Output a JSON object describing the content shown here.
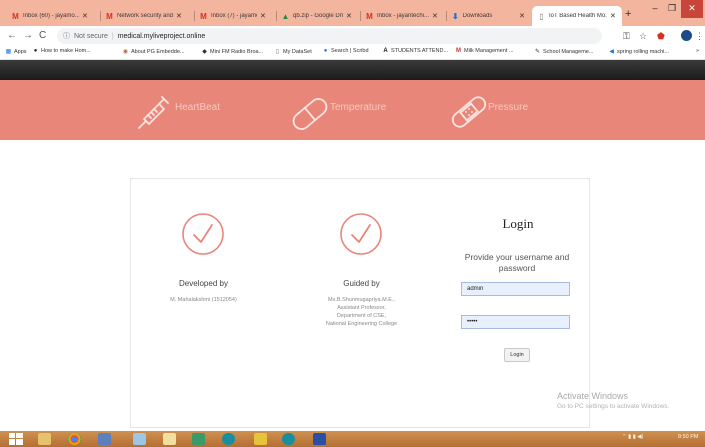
{
  "browser": {
    "tabs": [
      {
        "title": "Inbox (60) - jayamo..."
      },
      {
        "title": "Network security and..."
      },
      {
        "title": "Inbox (7) - jayamoha..."
      },
      {
        "title": "qb.zip - Google Drive"
      },
      {
        "title": "Inbox - jayantechi..."
      },
      {
        "title": "Downloads"
      },
      {
        "title": "IoT Based Health Mo..."
      }
    ],
    "address": {
      "security_label": "Not secure",
      "url": "medical.myliveproject.online"
    },
    "bookmarks": [
      {
        "label": "Apps"
      },
      {
        "label": "How to make Hom..."
      },
      {
        "label": "About PG Embedde..."
      },
      {
        "label": "Mini FM Radio Broa..."
      },
      {
        "label": "My DataSet"
      },
      {
        "label": "Search | Scribd"
      },
      {
        "label": "STUDENTS ATTEND..."
      },
      {
        "label": "Milk Management ..."
      },
      {
        "label": "School Manageme..."
      },
      {
        "label": "spring rolling machi..."
      }
    ],
    "more_bookmarks": "»"
  },
  "header": {
    "items": [
      {
        "label": "HeartBeat"
      },
      {
        "label": "Temperature"
      },
      {
        "label": "Pressure"
      }
    ]
  },
  "panel": {
    "developed": {
      "title": "Developed by",
      "name": "M. Mahalakshmi (1512054)"
    },
    "guided": {
      "title": "Guided by",
      "line1": "Ms.B.Shunmugapriya.M.E.,",
      "line2": "Assistant Professor,",
      "line3": "Department of CSE,",
      "line4": "National Engineering College"
    },
    "login": {
      "title": "Login",
      "subtitle": "Provide your username and password",
      "username_value": "admin",
      "password_value": "•••••",
      "button": "Login"
    }
  },
  "watermark": {
    "line1": "Activate Windows",
    "line2": "Go to PC settings to activate Windows."
  },
  "taskbar": {
    "time": "8:50 PM"
  },
  "colors": {
    "header": "#e8867a",
    "tabstrip": "#f3b59e",
    "taskbar": "#c07a3c"
  }
}
